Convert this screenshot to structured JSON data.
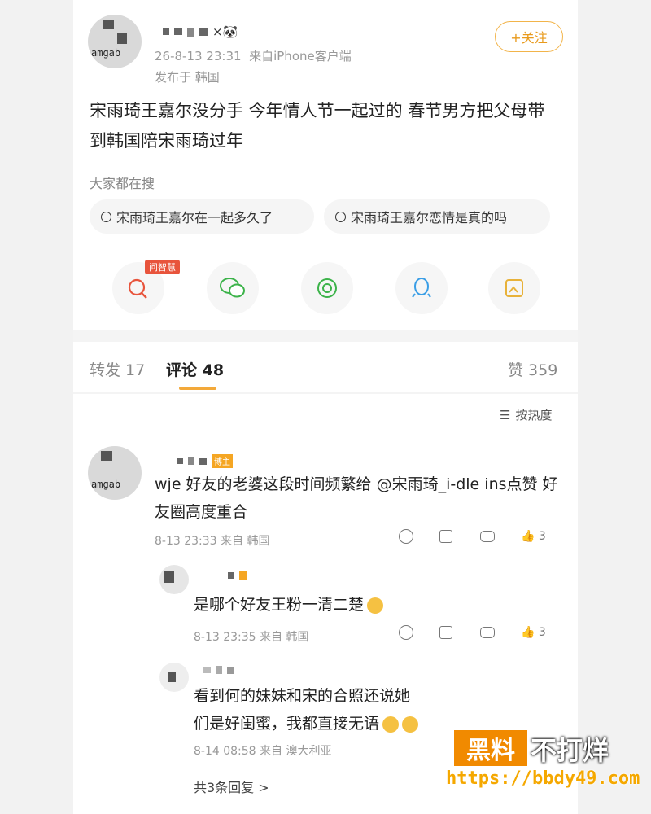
{
  "post": {
    "avatar_text": "amgab",
    "username_suffix": "×🐼",
    "timestamp": "26-8-13 23:31",
    "source": "来自iPhone客户端",
    "location": "发布于 韩国",
    "follow_label": "+关注",
    "content": "宋雨琦王嘉尔没分手 今年情人节一起过的 春节男方把父母带到韩国陪宋雨琦过年",
    "search_title": "大家都在搜",
    "chips": [
      "宋雨琦王嘉尔在一起多久了",
      "宋雨琦王嘉尔恋情是真的吗"
    ],
    "share_badge": "问智慧",
    "share_icons": [
      "ai-search-icon",
      "wechat-icon",
      "moments-icon",
      "qq-icon",
      "save-image-icon"
    ]
  },
  "tabs": {
    "repost": "转发 17",
    "comments": "评论 48",
    "likes": "赞 359"
  },
  "sort_label": "按热度",
  "comments": [
    {
      "avatar_text": "amgab",
      "badge": "博主",
      "text": "wje 好友的老婆这段时间频繁给 @宋雨琦_i-dle ins点赞 好友圈高度重合",
      "meta": "8-13 23:33 来自 韩国",
      "likes": "3"
    },
    {
      "text": "是哪个好友王粉一清二楚",
      "meta": "8-13 23:35 来自 韩国",
      "likes": "3"
    },
    {
      "text": "看到何的妹妹和宋的合照还说她们是好闺蜜，我都直接无语",
      "meta": "8-14 08:58 来自 澳大利亚"
    }
  ],
  "more_replies": "共3条回复 >",
  "watermark": {
    "box": "黑料",
    "text": "不打烊",
    "url": "https://bbdy49.com"
  },
  "colors": {
    "accent": "#f3a93a",
    "follow": "#e89a1c",
    "badge": "#e8543c"
  }
}
